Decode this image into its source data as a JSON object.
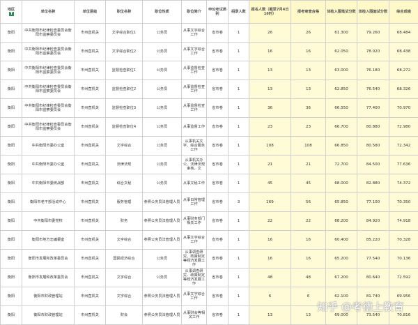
{
  "headers": {
    "region": "地区",
    "unit_name": "单位名称",
    "unit_level": "单位层级",
    "position_name": "职位名称",
    "position_nature": "职位性质",
    "position_intro": "职位简介",
    "exam_type": "申论考试类别",
    "recruit_num": "招录人数",
    "applicants": "报名人数（截至7月4日16时）",
    "review_passed": "报考审查合格",
    "written_score": "体检入围笔试分数",
    "interview_score": "体检入围面试分数",
    "total_score": "综合成绩"
  },
  "rows": [
    {
      "region": "衡阳",
      "unit": "中共衡阳市纪律检查委员会衡阳市监察委员会",
      "level": "市州直机关",
      "position": "文字综合职位1",
      "nature": "公务员",
      "intro": "从事文字综合工作",
      "exam": "省市卷",
      "recruit": "1",
      "applicants": "26",
      "passed": "26",
      "written": "61.300",
      "interview": "79.260",
      "total": "68.484"
    },
    {
      "region": "衡阳",
      "unit": "中共衡阳市纪律检查委员会衡阳市监察委员会",
      "level": "市州直机关",
      "position": "文字综合职位2",
      "nature": "公务员",
      "intro": "从事文字综合工作",
      "exam": "省市卷",
      "recruit": "1",
      "applicants": "16",
      "passed": "16",
      "written": "62.050",
      "interview": "78.020",
      "total": "68.438"
    },
    {
      "region": "衡阳",
      "unit": "中共衡阳市纪律检查委员会衡阳市监察委员会",
      "level": "市州直机关",
      "position": "监督检查职位1",
      "nature": "公务员",
      "intro": "从事监督检查工作",
      "exam": "省市卷",
      "recruit": "1",
      "applicants": "13",
      "passed": "13",
      "written": "63.000",
      "interview": "76.180",
      "total": "68.272"
    },
    {
      "region": "衡阳",
      "unit": "中共衡阳市纪律检查委员会衡阳市监察委员会",
      "level": "市州直机关",
      "position": "监督检查职位2",
      "nature": "公务员",
      "intro": "从事监督检查工作",
      "exam": "省市卷",
      "recruit": "1",
      "applicants": "13",
      "passed": "13",
      "written": "62.850",
      "interview": "76.540",
      "total": "68.326"
    },
    {
      "region": "衡阳",
      "unit": "中共衡阳市纪律检查委员会衡阳市监察委员会",
      "level": "市州直机关",
      "position": "监督检查职位3",
      "nature": "公务员",
      "intro": "从事监督检查工作",
      "exam": "省市卷",
      "recruit": "1",
      "applicants": "36",
      "passed": "36",
      "written": "66.550",
      "interview": "77.400",
      "total": "70.970"
    },
    {
      "region": "衡阳",
      "unit": "中共衡阳市纪律检查委员会衡阳市监察委员会",
      "level": "市州直机关",
      "position": "监督检查职位4",
      "nature": "公务员",
      "intro": "从事监督工作",
      "exam": "省市卷",
      "recruit": "1",
      "applicants": "23",
      "passed": "23",
      "written": "66.700",
      "interview": "80.880",
      "total": "72.980"
    },
    {
      "region": "衡阳",
      "unit": "中共衡阳市委办公室",
      "level": "市州直机关",
      "position": "文字综合",
      "nature": "公务员",
      "intro": "从事机关文字、综合服务工作",
      "exam": "省市卷",
      "recruit": "1",
      "applicants": "108",
      "passed": "108",
      "written": "66.850",
      "interview": "80.580",
      "total": "72.342"
    },
    {
      "region": "衡阳",
      "unit": "中共衡阳市委办公室",
      "level": "市州直机关",
      "position": "法律法规",
      "nature": "公务员",
      "intro": "从事机关办公、法律法规审核、文",
      "exam": "省市卷",
      "recruit": "1",
      "applicants": "21",
      "passed": "21",
      "written": "72.700",
      "interview": "84.500",
      "total": "77.636"
    },
    {
      "region": "衡阳",
      "unit": "中共衡阳市委统战部",
      "level": "市州直机关",
      "position": "综合文秘",
      "nature": "公务员",
      "intro": "从事文秘工作",
      "exam": "省市卷",
      "recruit": "1",
      "applicants": "45",
      "passed": "45",
      "written": "68.000",
      "interview": "82.880",
      "total": "74.372"
    },
    {
      "region": "衡阳",
      "unit": "衡阳市老干部活动中心",
      "level": "市州直机关",
      "position": "服务管理",
      "nature": "参照公务员法管理人员",
      "intro": "从事日常管理工作",
      "exam": "省市卷",
      "recruit": "3",
      "applicants": "169",
      "passed": "56",
      "written": "65.850",
      "interview": "77.100",
      "total": "70.350"
    },
    {
      "region": "衡阳",
      "unit": "中共衡阳市委党校",
      "level": "市州直机关",
      "position": "财务",
      "nature": "参照公务员法管理人员",
      "intro": "从事财务部门相关工作",
      "exam": "省市卷",
      "recruit": "1",
      "applicants": "22",
      "passed": "22",
      "written": "68.200",
      "interview": "84.920",
      "total": "74.918"
    },
    {
      "region": "衡阳",
      "unit": "衡阳市地方志编纂室",
      "level": "市州直机关",
      "position": "文字综合",
      "nature": "参照公务员法管理人员",
      "intro": "从事文字综合工作",
      "exam": "省市卷",
      "recruit": "1",
      "applicants": "16",
      "passed": "16",
      "written": "60.400",
      "interview": "85.220",
      "total": "70.328"
    },
    {
      "region": "衡阳",
      "unit": "衡阳市发展和改革委员会",
      "level": "市州直机关",
      "position": "国民经济综合",
      "nature": "公务员",
      "intro": "从事调查研究、政策制定等经济发展工作",
      "exam": "省市卷",
      "recruit": "1",
      "applicants": "16",
      "passed": "16",
      "written": "65.200",
      "interview": "77.540",
      "total": "70.136"
    },
    {
      "region": "衡阳",
      "unit": "衡阳市发展和改革委员会",
      "level": "市州直机关",
      "position": "文字综合",
      "nature": "公务员",
      "intro": "从事调查研究、政策制定等经济发展工作",
      "exam": "省市卷",
      "recruit": "1",
      "applicants": "48",
      "passed": "48",
      "written": "67.200",
      "interview": "80.640",
      "total": "72.592"
    },
    {
      "region": "衡阳",
      "unit": "衡阳市财政管理站",
      "level": "市州直机关",
      "position": "文字综合",
      "nature": "参照公务员法管理人员",
      "intro": "从事文字综合工作",
      "exam": "省市卷",
      "recruit": "1",
      "applicants": "6",
      "passed": "6",
      "written": "62.100",
      "interview": "81.740",
      "total": "69.956"
    },
    {
      "region": "衡阳",
      "unit": "衡阳市财政管理站",
      "level": "市州直机关",
      "position": "财会",
      "nature": "参照公务员法管理人员",
      "intro": "从事财会等相关工作",
      "exam": "省市卷",
      "recruit": "1",
      "applicants": "13",
      "passed": "13",
      "written": "69.000",
      "interview": "73.540",
      "total": "70.816"
    }
  ],
  "filter_badge": "T",
  "watermark": "知乎 @考德上教育"
}
